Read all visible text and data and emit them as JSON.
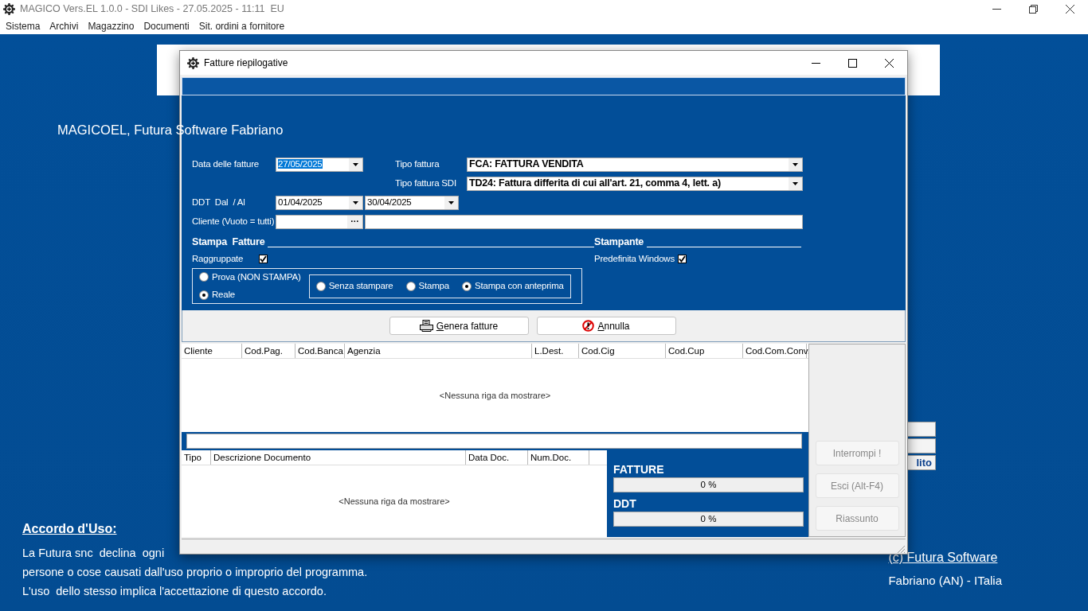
{
  "app": {
    "title": "MAGICO Vers.EL 1.0.0 - SDI Likes - 27.05.2025 - 11:11  EU",
    "menu": [
      "Sistema",
      "Archivi",
      "Magazzino",
      "Documenti",
      "Sit. ordini a fornitore"
    ]
  },
  "background": {
    "banner": "MAGICOEL, Futura Software Fabriano",
    "side_label": "lito",
    "agreement_title": "Accordo d'Uso:",
    "agreement_lines": [
      "La Futura snc  declina  ogni",
      "persone o cose causati dall'uso proprio o improprio del programma.",
      "L'uso  dello stesso implica l'accettazione di questo accordo."
    ],
    "credit_link": "(c) Futura Software",
    "credit_place": "Fabriano (AN) - ITalia"
  },
  "dialog": {
    "title": "Fatture riepilogative",
    "invoice_date": {
      "label": "Data delle fatture",
      "value": "27/05/2025",
      "selected": true
    },
    "invoice_type": {
      "label": "Tipo fattura",
      "value": "FCA: FATTURA VENDITA"
    },
    "sdi_type": {
      "label": "Tipo fattura SDI",
      "value": "TD24: Fattura differita di cui all'art. 21, comma 4, lett. a)"
    },
    "ddt_range": {
      "label": "DDT  Dal  / Al",
      "from": "01/04/2025",
      "to": "30/04/2025"
    },
    "customer": {
      "label": "Cliente (Vuoto = tutti)",
      "browse": "···"
    },
    "print_section": {
      "title": "Stampa  Fatture",
      "option": {
        "label": "Raggruppate",
        "checked": true
      }
    },
    "printer_section": {
      "title": "Stampante",
      "option": {
        "label": "Predefinita Windows",
        "checked": true
      }
    },
    "mode_options": [
      {
        "label": "Prova (NON STAMPA)",
        "selected": false
      },
      {
        "label": "Reale",
        "selected": true
      }
    ],
    "output_options": [
      {
        "label": "Senza stampare",
        "selected": false
      },
      {
        "label": "Stampa",
        "selected": false
      },
      {
        "label": "Stampa con anteprima",
        "selected": true
      }
    ],
    "actions": [
      {
        "label": "Genera fatture",
        "kind": "print"
      },
      {
        "label": "Annulla",
        "kind": "cancel"
      }
    ],
    "customers_table": {
      "columns": [
        "Cliente",
        "Cod.Pag.",
        "Cod.Banca",
        "Agenzia",
        "L.Dest.",
        "Cod.Cig",
        "Cod.Cup",
        "Cod.Com.Conv."
      ],
      "empty_text": "<Nessuna riga da mostrare>"
    },
    "documents_table": {
      "columns": [
        "Tipo",
        "Descrizione Documento",
        "Data Doc.",
        "Num.Doc."
      ],
      "empty_text": "<Nessuna riga da mostrare>"
    },
    "progress": [
      {
        "label": "FATTURE",
        "reading": "0 %",
        "level": 0
      },
      {
        "label": "DDT",
        "reading": "0 %",
        "level": 0
      }
    ],
    "side_buttons": [
      {
        "label": "Interrompi !",
        "disabled": true
      },
      {
        "label": "Esci (Alt-F4)",
        "disabled": true
      },
      {
        "label": "Riassunto",
        "disabled": true
      }
    ]
  }
}
